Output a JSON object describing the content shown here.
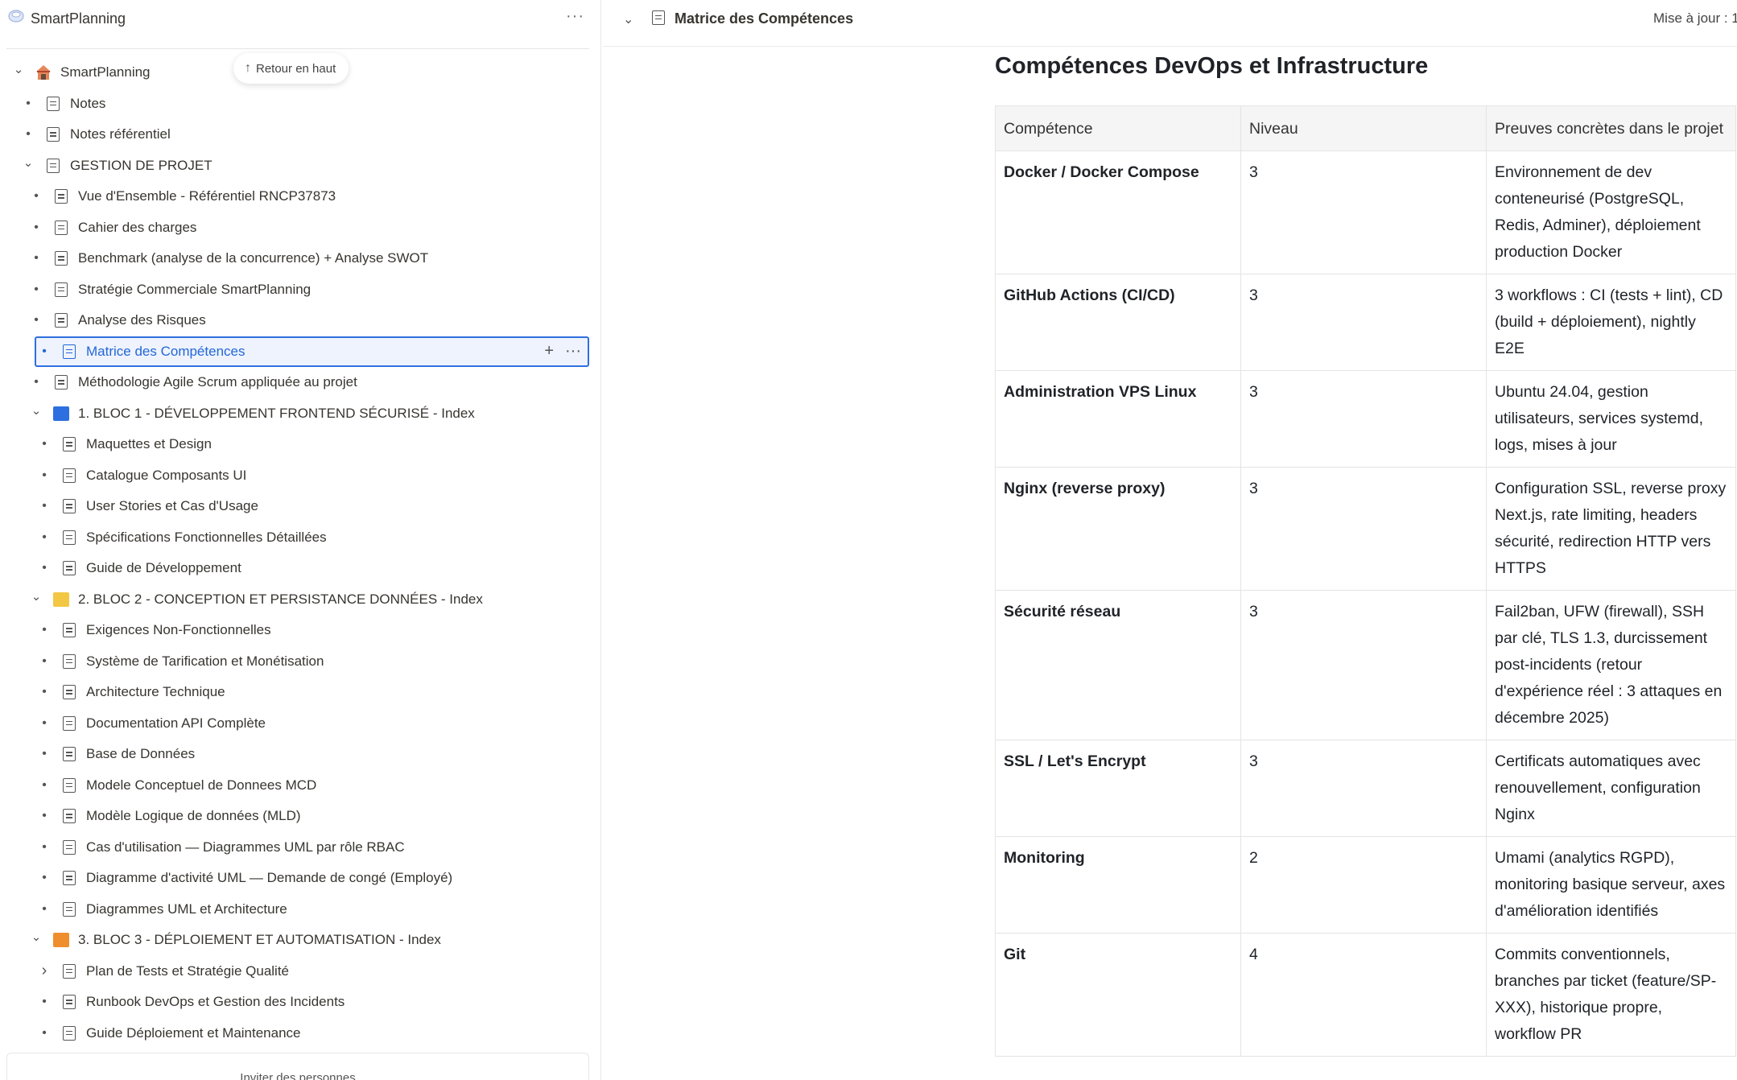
{
  "sidebar": {
    "workspace_name": "SmartPlanning",
    "more_glyph": "···",
    "back_to_top": "Retour en haut",
    "invite_label": "Inviter des personnes",
    "tree": [
      {
        "label": "SmartPlanning",
        "depth": 0,
        "lead": "chevron-down",
        "icon": "house-emoji"
      },
      {
        "label": "Notes",
        "depth": 1,
        "lead": "bullet",
        "icon": "page"
      },
      {
        "label": "Notes référentiel",
        "depth": 1,
        "lead": "bullet",
        "icon": "page"
      },
      {
        "label": "GESTION DE PROJET",
        "depth": 1,
        "lead": "chevron-down",
        "icon": "page"
      },
      {
        "label": "Vue d'Ensemble - Référentiel RNCP37873",
        "depth": 2,
        "lead": "bullet",
        "icon": "page"
      },
      {
        "label": "Cahier des charges",
        "depth": 2,
        "lead": "bullet",
        "icon": "page"
      },
      {
        "label": "Benchmark (analyse de la concurrence) + Analyse SWOT",
        "depth": 2,
        "lead": "bullet",
        "icon": "page"
      },
      {
        "label": "Stratégie Commerciale SmartPlanning",
        "depth": 2,
        "lead": "bullet",
        "icon": "page"
      },
      {
        "label": "Analyse des Risques",
        "depth": 2,
        "lead": "bullet",
        "icon": "page"
      },
      {
        "label": "Matrice des Compétences",
        "depth": 2,
        "lead": "bullet",
        "icon": "page",
        "active": true
      },
      {
        "label": "Méthodologie Agile Scrum appliquée au projet",
        "depth": 2,
        "lead": "bullet",
        "icon": "page"
      },
      {
        "label": "1. BLOC 1 - DÉVELOPPEMENT FRONTEND SÉCURISÉ - Index",
        "depth": 2,
        "lead": "chevron-down",
        "icon": "square-blue"
      },
      {
        "label": "Maquettes et Design",
        "depth": 3,
        "lead": "bullet",
        "icon": "page"
      },
      {
        "label": "Catalogue Composants UI",
        "depth": 3,
        "lead": "bullet",
        "icon": "page"
      },
      {
        "label": "User Stories et Cas d'Usage",
        "depth": 3,
        "lead": "bullet",
        "icon": "page"
      },
      {
        "label": "Spécifications Fonctionnelles Détaillées",
        "depth": 3,
        "lead": "bullet",
        "icon": "page"
      },
      {
        "label": "Guide de Développement",
        "depth": 3,
        "lead": "bullet",
        "icon": "page"
      },
      {
        "label": "2. BLOC 2 - CONCEPTION ET PERSISTANCE DONNÉES - Index",
        "depth": 2,
        "lead": "chevron-down",
        "icon": "square-yellow"
      },
      {
        "label": "Exigences Non-Fonctionnelles",
        "depth": 3,
        "lead": "bullet",
        "icon": "page"
      },
      {
        "label": "Système de Tarification et Monétisation",
        "depth": 3,
        "lead": "bullet",
        "icon": "page"
      },
      {
        "label": "Architecture Technique",
        "depth": 3,
        "lead": "bullet",
        "icon": "page"
      },
      {
        "label": "Documentation API Complète",
        "depth": 3,
        "lead": "bullet",
        "icon": "page"
      },
      {
        "label": "Base de Données",
        "depth": 3,
        "lead": "bullet",
        "icon": "page"
      },
      {
        "label": "Modele Conceptuel de Donnees MCD",
        "depth": 3,
        "lead": "bullet",
        "icon": "page"
      },
      {
        "label": "Modèle Logique de données (MLD)",
        "depth": 3,
        "lead": "bullet",
        "icon": "page"
      },
      {
        "label": "Cas d'utilisation — Diagrammes UML par rôle RBAC",
        "depth": 3,
        "lead": "bullet",
        "icon": "page"
      },
      {
        "label": "Diagramme d'activité UML — Demande de congé (Employé)",
        "depth": 3,
        "lead": "bullet",
        "icon": "page"
      },
      {
        "label": "Diagrammes UML et Architecture",
        "depth": 3,
        "lead": "bullet",
        "icon": "page"
      },
      {
        "label": "3. BLOC 3 - DÉPLOIEMENT ET AUTOMATISATION - Index",
        "depth": 2,
        "lead": "chevron-down",
        "icon": "square-orange"
      },
      {
        "label": "Plan de Tests et Stratégie Qualité",
        "depth": 3,
        "lead": "chevron-right",
        "icon": "page"
      },
      {
        "label": "Runbook DevOps et Gestion des Incidents",
        "depth": 3,
        "lead": "bullet",
        "icon": "page"
      },
      {
        "label": "Guide Déploiement et Maintenance",
        "depth": 3,
        "lead": "bullet",
        "icon": "page"
      }
    ]
  },
  "topbar": {
    "title": "Matrice des Compétences",
    "update_text": "Mise à jour : 1"
  },
  "content": {
    "heading": "Compétences DevOps et Infrastructure",
    "columns": [
      "Compétence",
      "Niveau",
      "Preuves concrètes dans le projet"
    ],
    "rows": [
      [
        "Docker / Docker Compose",
        "3",
        "Environnement de dev conteneurisé (PostgreSQL, Redis, Adminer), déploiement production Docker"
      ],
      [
        "GitHub Actions (CI/CD)",
        "3",
        "3 workflows : CI (tests + lint), CD (build + déploiement), nightly E2E"
      ],
      [
        "Administration VPS Linux",
        "3",
        "Ubuntu 24.04, gestion utilisateurs, services systemd, logs, mises à jour"
      ],
      [
        "Nginx (reverse proxy)",
        "3",
        "Configuration SSL, reverse proxy Next.js, rate limiting, headers sécurité, redirection HTTP vers HTTPS"
      ],
      [
        "Sécurité réseau",
        "3",
        "Fail2ban, UFW (firewall), SSH par clé, TLS 1.3, durcissement post-incidents (retour d'expérience réel : 3 attaques en décembre 2025)"
      ],
      [
        "SSL / Let's Encrypt",
        "3",
        "Certificats automatiques avec renouvellement, configuration Nginx"
      ],
      [
        "Monitoring",
        "2",
        "Umami (analytics RGPD), monitoring basique serveur, axes d'amélioration identifiés"
      ],
      [
        "Git",
        "4",
        "Commits conventionnels, branches par ticket (feature/SP-XXX), historique propre, workflow PR"
      ]
    ]
  },
  "colors": {
    "active": "#2467d6",
    "square-blue": "#2d6fe0",
    "square-yellow": "#f2c744",
    "square-orange": "#ef8e2c"
  }
}
